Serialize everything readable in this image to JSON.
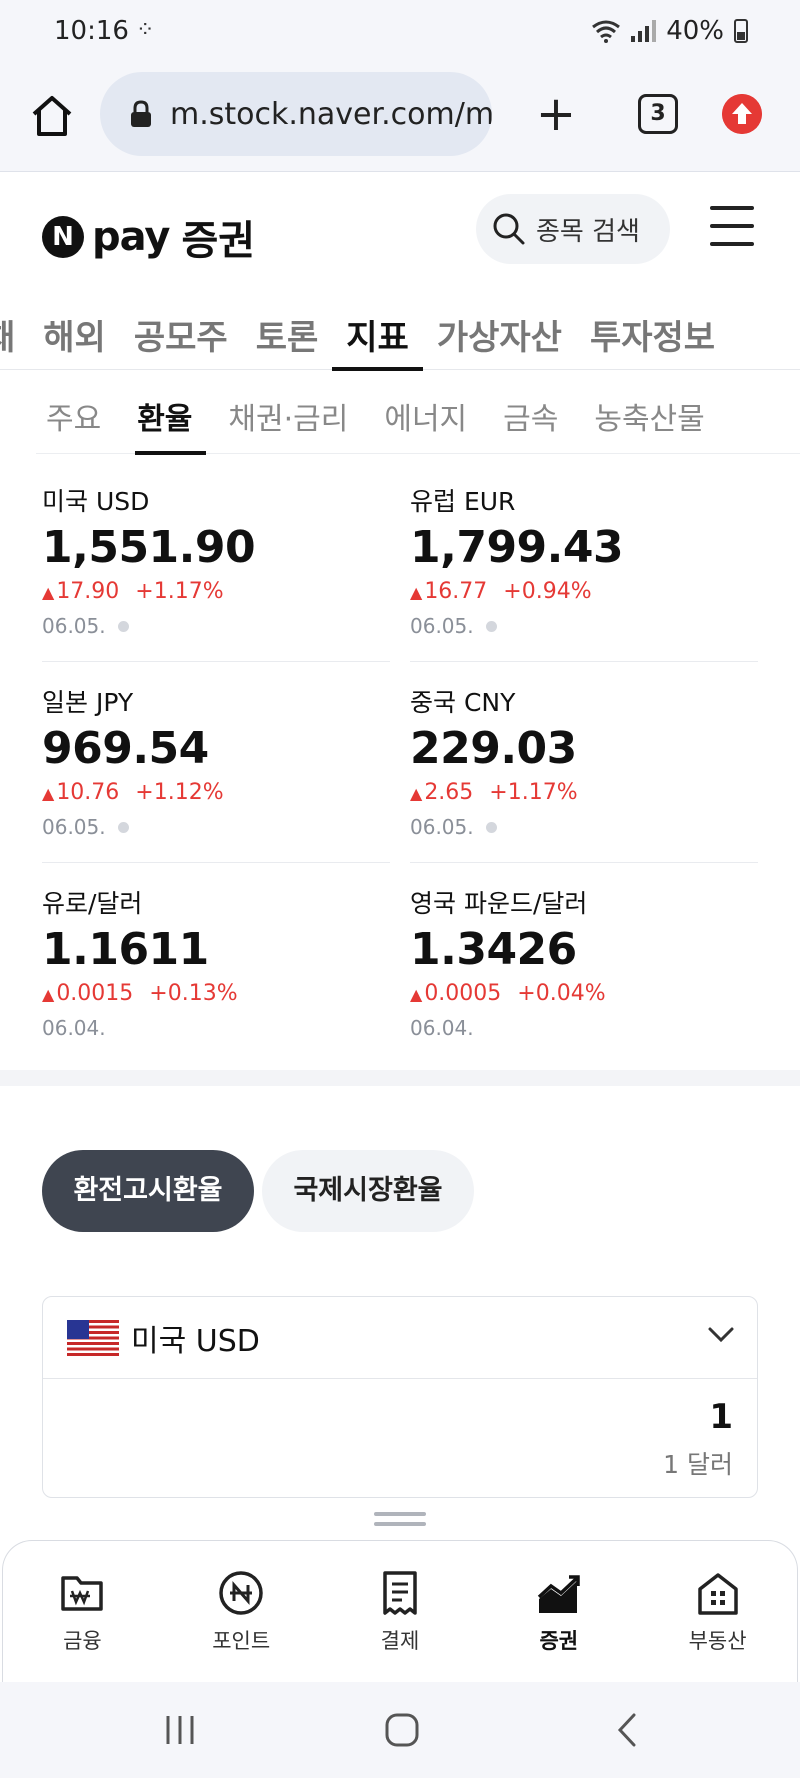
{
  "status_bar": {
    "time": "10:16",
    "battery": "40%"
  },
  "browser": {
    "url": "m.stock.naver.com/m",
    "tab_count": "3"
  },
  "header": {
    "logo_pay": "pay",
    "logo_name": "증권",
    "search_placeholder": "종목 검색"
  },
  "main_tabs": [
    {
      "label": "채"
    },
    {
      "label": "해외"
    },
    {
      "label": "공모주"
    },
    {
      "label": "토론"
    },
    {
      "label": "지표"
    },
    {
      "label": "가상자산"
    },
    {
      "label": "투자정보"
    }
  ],
  "sub_tabs": [
    {
      "label": "주요"
    },
    {
      "label": "환율"
    },
    {
      "label": "채권·금리"
    },
    {
      "label": "에너지"
    },
    {
      "label": "금속"
    },
    {
      "label": "농축산물"
    }
  ],
  "rates": [
    {
      "name": "미국 USD",
      "value": "1,551.90",
      "change": "17.90",
      "percent": "+1.17%",
      "date": "06.05."
    },
    {
      "name": "유럽 EUR",
      "value": "1,799.43",
      "change": "16.77",
      "percent": "+0.94%",
      "date": "06.05."
    },
    {
      "name": "일본 JPY",
      "value": "969.54",
      "change": "10.76",
      "percent": "+1.12%",
      "date": "06.05."
    },
    {
      "name": "중국 CNY",
      "value": "229.03",
      "change": "2.65",
      "percent": "+1.17%",
      "date": "06.05."
    },
    {
      "name": "유로/달러",
      "value": "1.1611",
      "change": "0.0015",
      "percent": "+0.13%",
      "date": "06.04."
    },
    {
      "name": "영국 파운드/달러",
      "value": "1.3426",
      "change": "0.0005",
      "percent": "+0.04%",
      "date": "06.04."
    }
  ],
  "toggle": {
    "primary": "환전고시환율",
    "secondary": "국제시장환율"
  },
  "converter": {
    "currency": "미국 USD",
    "amount": "1",
    "unit": "1 달러"
  },
  "bottom_nav": [
    {
      "label": "금융"
    },
    {
      "label": "포인트"
    },
    {
      "label": "결제"
    },
    {
      "label": "증권"
    },
    {
      "label": "부동산"
    }
  ],
  "colors": {
    "up_red": "#e53935",
    "toggle_active": "#3f4550"
  }
}
